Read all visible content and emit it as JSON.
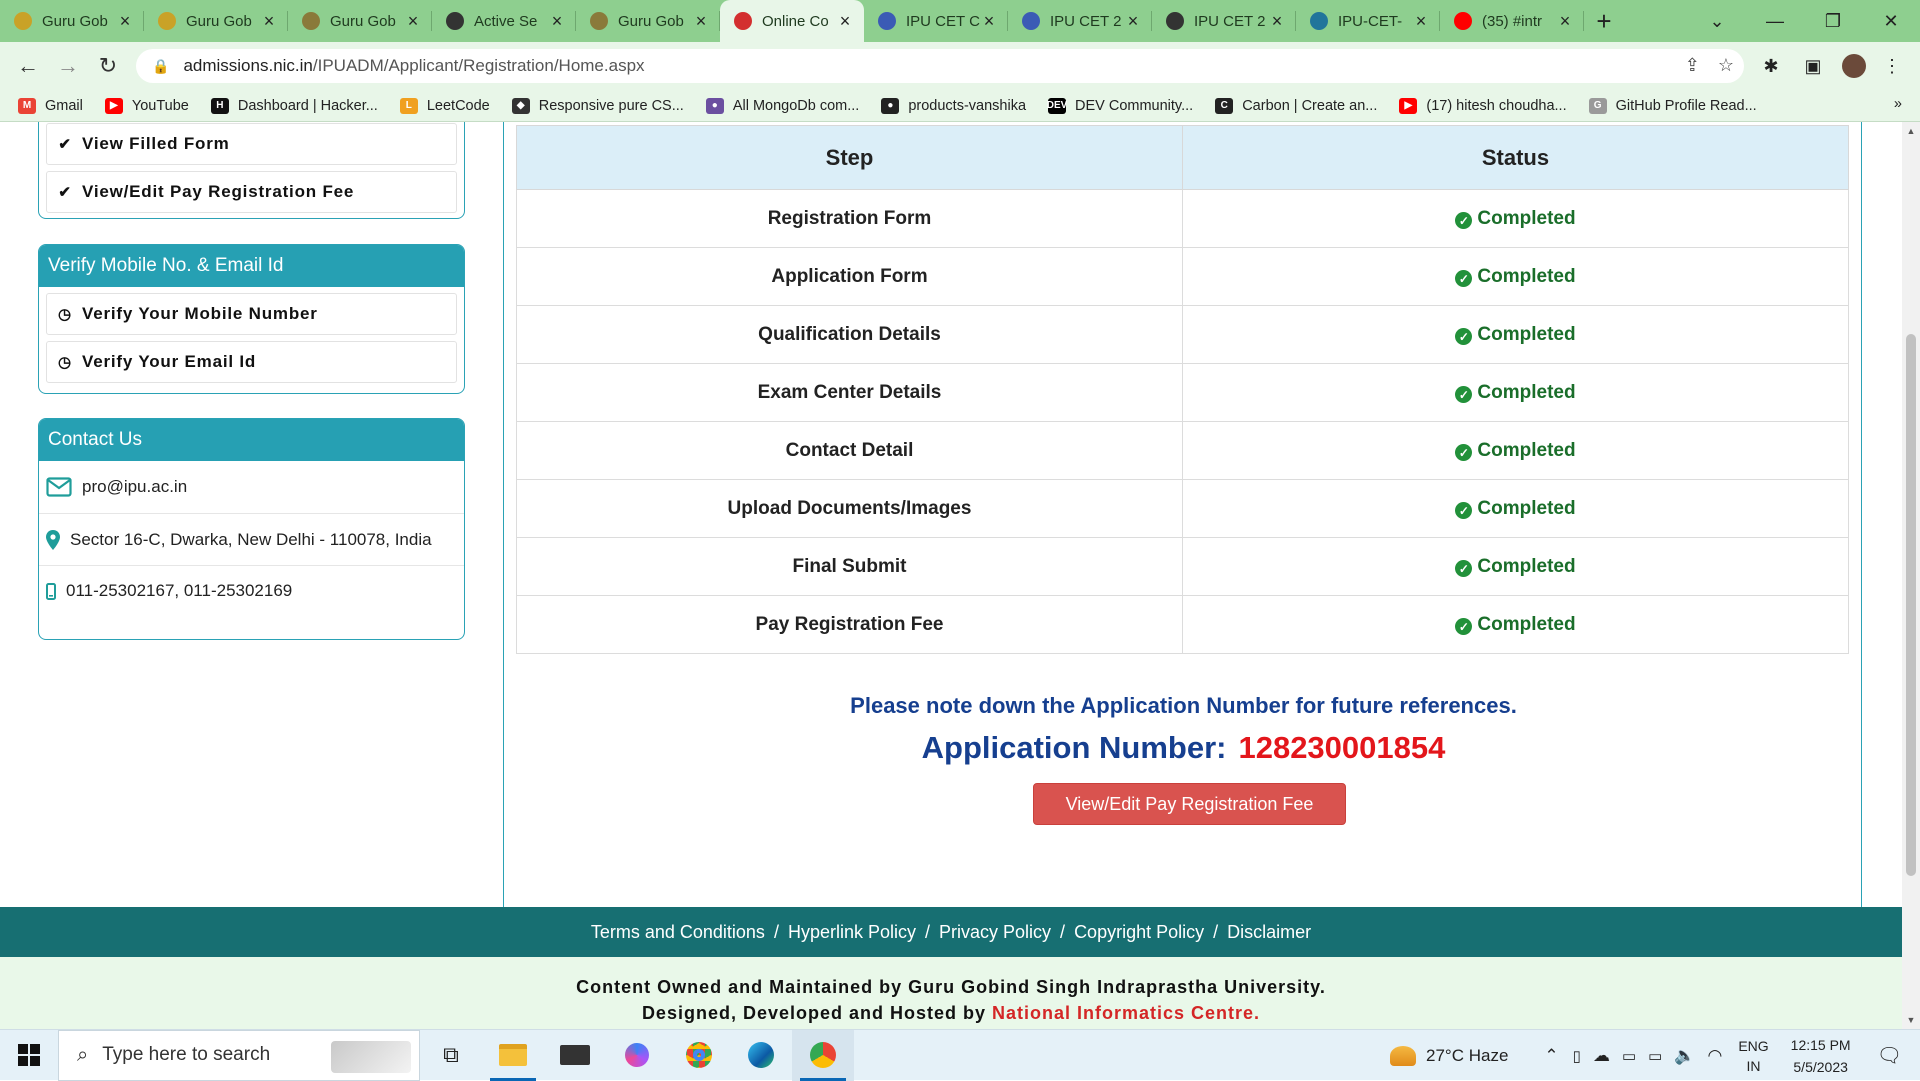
{
  "browser": {
    "tabs": [
      {
        "title": "Guru Gob",
        "favicon_color": "#c9a227",
        "active": false
      },
      {
        "title": "Guru Gob",
        "favicon_color": "#c9a227",
        "active": false
      },
      {
        "title": "Guru Gob",
        "favicon_color": "#8a7a3a",
        "active": false
      },
      {
        "title": "Active Se",
        "favicon_color": "#333333",
        "active": false
      },
      {
        "title": "Guru Gob",
        "favicon_color": "#8a7a3a",
        "active": false
      },
      {
        "title": "Online Co",
        "favicon_color": "#d32f2f",
        "active": true
      },
      {
        "title": "IPU CET C",
        "favicon_color": "#3b5bb5",
        "active": false
      },
      {
        "title": "IPU CET 2",
        "favicon_color": "#3b5bb5",
        "active": false
      },
      {
        "title": "IPU CET 2",
        "favicon_color": "#333333",
        "active": false
      },
      {
        "title": "IPU-CET-",
        "favicon_color": "#21759b",
        "active": false
      },
      {
        "title": "(35) #intr",
        "favicon_color": "#ff0000",
        "active": false
      }
    ],
    "url_host": "admissions.nic.in",
    "url_path": "/IPUADM/Applicant/Registration/Home.aspx",
    "bookmarks": [
      {
        "label": "Gmail",
        "color": "#ea4335",
        "icon": "M"
      },
      {
        "label": "YouTube",
        "color": "#ff0000",
        "icon": "▶"
      },
      {
        "label": "Dashboard | Hacker...",
        "color": "#111111",
        "icon": "H"
      },
      {
        "label": "LeetCode",
        "color": "#f0a020",
        "icon": "L"
      },
      {
        "label": "Responsive pure CS...",
        "color": "#333333",
        "icon": "◆"
      },
      {
        "label": "All MongoDb com...",
        "color": "#6b4fa0",
        "icon": "●"
      },
      {
        "label": "products-vanshika",
        "color": "#222222",
        "icon": "●"
      },
      {
        "label": "DEV Community...",
        "color": "#000000",
        "icon": "DEV"
      },
      {
        "label": "Carbon | Create an...",
        "color": "#222222",
        "icon": "C"
      },
      {
        "label": "(17) hitesh choudha...",
        "color": "#ff0000",
        "icon": "▶"
      },
      {
        "label": "GitHub Profile Read...",
        "color": "#9a9a9a",
        "icon": "G"
      }
    ]
  },
  "sidebar": {
    "form_items": [
      {
        "label": "View Filled Form"
      },
      {
        "label": "View/Edit Pay Registration Fee"
      }
    ],
    "verify": {
      "title": "Verify Mobile No. & Email Id",
      "items": [
        {
          "label": "Verify Your Mobile Number"
        },
        {
          "label": "Verify Your Email Id"
        }
      ]
    },
    "contact": {
      "title": "Contact Us",
      "email": "pro@ipu.ac.in",
      "address": "Sector 16-C, Dwarka, New Delhi - 110078, India",
      "phone": "011-25302167, 011-25302169"
    }
  },
  "main": {
    "table": {
      "headers": [
        "Step",
        "Status"
      ],
      "rows": [
        {
          "step": "Registration Form",
          "status": "Completed"
        },
        {
          "step": "Application Form",
          "status": "Completed"
        },
        {
          "step": "Qualification Details",
          "status": "Completed"
        },
        {
          "step": "Exam Center Details",
          "status": "Completed"
        },
        {
          "step": "Contact Detail",
          "status": "Completed"
        },
        {
          "step": "Upload Documents/Images",
          "status": "Completed"
        },
        {
          "step": "Final Submit",
          "status": "Completed"
        },
        {
          "step": "Pay Registration Fee",
          "status": "Completed"
        }
      ]
    },
    "note": "Please note down the Application Number for future references.",
    "app_number_label": "Application Number:",
    "app_number": "128230001854",
    "fee_button": "View/Edit Pay Registration Fee"
  },
  "footer": {
    "links": [
      "Terms and Conditions",
      "Hyperlink Policy",
      "Privacy Policy",
      "Copyright Policy",
      "Disclaimer"
    ],
    "owned": "Content Owned and Maintained by Guru Gobind Singh Indraprastha University.",
    "designed": "Designed, Developed and Hosted by",
    "nic": "National Informatics Centre."
  },
  "taskbar": {
    "search_placeholder": "Type here to search",
    "weather": "27°C  Haze",
    "lang1": "ENG",
    "lang2": "IN",
    "time": "12:15 PM",
    "date": "5/5/2023"
  }
}
